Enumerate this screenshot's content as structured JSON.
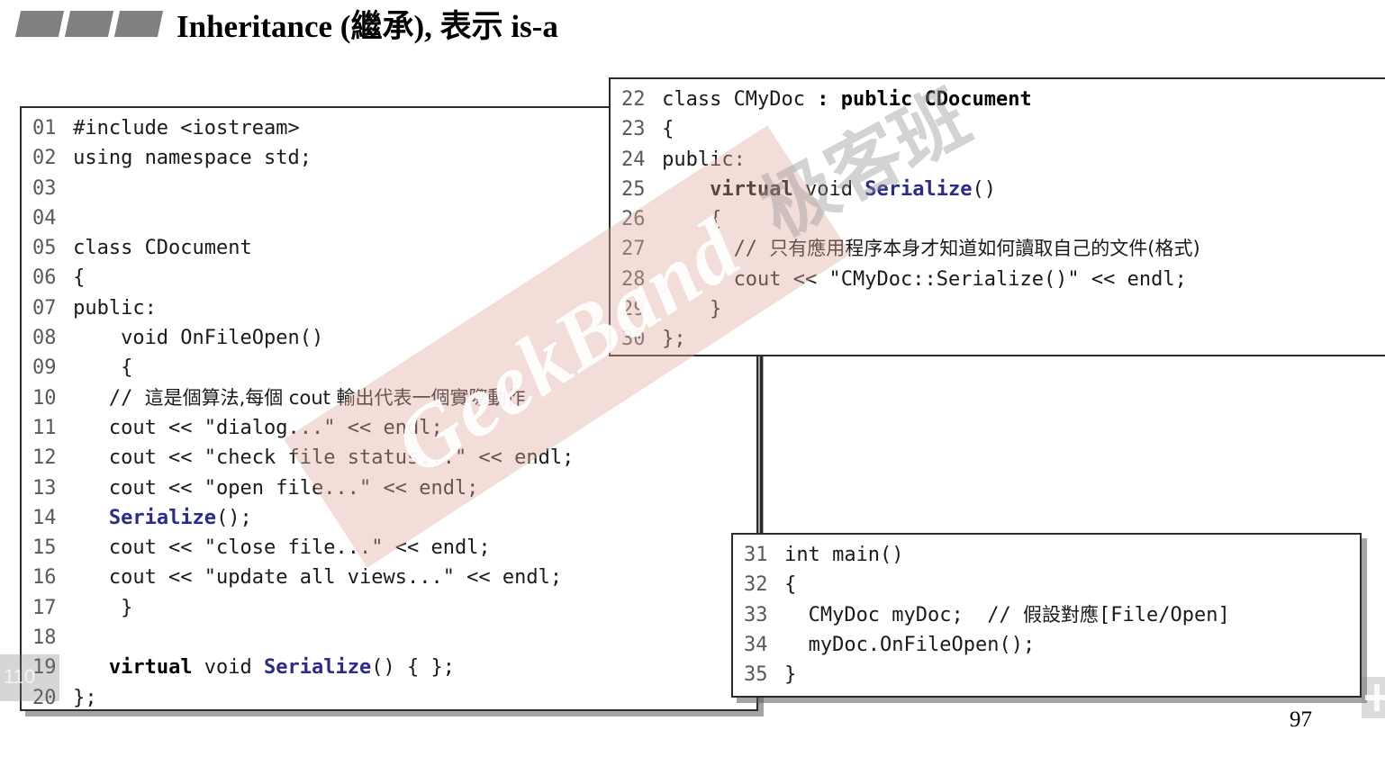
{
  "slide": {
    "title": "Inheritance (繼承), 表示 is-a",
    "page_number": "97",
    "decoration_marks": 3
  },
  "colors": {
    "title_mark": "#808080",
    "keyword_bold": "#000000",
    "function_blue": "#2b2b8c",
    "line_number": "#595959",
    "box_border": "#2b2b2b",
    "watermark_band": "#e2aaa0"
  },
  "watermarks": {
    "brand_latin": "GeekBand",
    "brand_chinese": "极客班"
  },
  "player_overlay": {
    "counter": "110",
    "plus_icon": "plus-icon"
  },
  "code_boxes": [
    {
      "id": "base-class",
      "lines": [
        {
          "n": "01",
          "segments": [
            {
              "t": "#include <iostream>",
              "style": "plain"
            }
          ]
        },
        {
          "n": "02",
          "segments": [
            {
              "t": "using namespace std;",
              "style": "plain"
            }
          ]
        },
        {
          "n": "03",
          "segments": [
            {
              "t": "",
              "style": "plain"
            }
          ]
        },
        {
          "n": "04",
          "segments": [
            {
              "t": "",
              "style": "plain"
            }
          ]
        },
        {
          "n": "05",
          "segments": [
            {
              "t": "class CDocument",
              "style": "plain"
            }
          ]
        },
        {
          "n": "06",
          "segments": [
            {
              "t": "{",
              "style": "plain"
            }
          ]
        },
        {
          "n": "07",
          "segments": [
            {
              "t": "public:",
              "style": "plain"
            }
          ]
        },
        {
          "n": "08",
          "segments": [
            {
              "t": "    void OnFileOpen()",
              "style": "plain"
            }
          ]
        },
        {
          "n": "09",
          "segments": [
            {
              "t": "    {",
              "style": "plain"
            }
          ]
        },
        {
          "n": "10",
          "segments": [
            {
              "t": "   // ",
              "style": "plain"
            },
            {
              "t": "這是個算法,每個 cout 輸出代表一個實際動作",
              "style": "zh"
            }
          ]
        },
        {
          "n": "11",
          "segments": [
            {
              "t": "   cout << \"dialog...\" << endl;",
              "style": "plain"
            }
          ]
        },
        {
          "n": "12",
          "segments": [
            {
              "t": "   cout << \"check file status...\" << endl;",
              "style": "plain"
            }
          ]
        },
        {
          "n": "13",
          "segments": [
            {
              "t": "   cout << \"open file...\" << endl;",
              "style": "plain"
            }
          ]
        },
        {
          "n": "14",
          "segments": [
            {
              "t": "   ",
              "style": "plain"
            },
            {
              "t": "Serialize",
              "style": "fn"
            },
            {
              "t": "();",
              "style": "plain"
            }
          ]
        },
        {
          "n": "15",
          "segments": [
            {
              "t": "   cout << \"close file...\" << endl;",
              "style": "plain"
            }
          ]
        },
        {
          "n": "16",
          "segments": [
            {
              "t": "   cout << \"update all views...\" << endl;",
              "style": "plain"
            }
          ]
        },
        {
          "n": "17",
          "segments": [
            {
              "t": "    }",
              "style": "plain"
            }
          ]
        },
        {
          "n": "18",
          "segments": [
            {
              "t": "",
              "style": "plain"
            }
          ]
        },
        {
          "n": "19",
          "segments": [
            {
              "t": "   ",
              "style": "plain"
            },
            {
              "t": "virtual",
              "style": "kw"
            },
            {
              "t": " void ",
              "style": "plain"
            },
            {
              "t": "Serialize",
              "style": "fn"
            },
            {
              "t": "() { };",
              "style": "plain"
            }
          ]
        },
        {
          "n": "20",
          "segments": [
            {
              "t": "};",
              "style": "plain"
            }
          ]
        }
      ]
    },
    {
      "id": "derived-class",
      "lines": [
        {
          "n": "22",
          "segments": [
            {
              "t": "class CMyDoc ",
              "style": "plain"
            },
            {
              "t": ": public CDocument",
              "style": "kw"
            }
          ]
        },
        {
          "n": "23",
          "segments": [
            {
              "t": "{",
              "style": "plain"
            }
          ]
        },
        {
          "n": "24",
          "segments": [
            {
              "t": "public:",
              "style": "plain"
            }
          ]
        },
        {
          "n": "25",
          "segments": [
            {
              "t": "    ",
              "style": "plain"
            },
            {
              "t": "virtual",
              "style": "kw"
            },
            {
              "t": " void ",
              "style": "plain"
            },
            {
              "t": "Serialize",
              "style": "fn"
            },
            {
              "t": "()",
              "style": "plain"
            }
          ]
        },
        {
          "n": "26",
          "segments": [
            {
              "t": "    {",
              "style": "plain"
            }
          ]
        },
        {
          "n": "27",
          "segments": [
            {
              "t": "      // ",
              "style": "plain"
            },
            {
              "t": "只有應用程序本身才知道如何讀取自己的文件(格式)",
              "style": "zh"
            }
          ]
        },
        {
          "n": "28",
          "segments": [
            {
              "t": "      cout << \"CMyDoc::Serialize()\" << endl;",
              "style": "plain"
            }
          ]
        },
        {
          "n": "29",
          "segments": [
            {
              "t": "    }",
              "style": "plain"
            }
          ]
        },
        {
          "n": "30",
          "segments": [
            {
              "t": "};",
              "style": "plain"
            }
          ]
        }
      ]
    },
    {
      "id": "main-function",
      "lines": [
        {
          "n": "31",
          "segments": [
            {
              "t": "int main()",
              "style": "plain"
            }
          ]
        },
        {
          "n": "32",
          "segments": [
            {
              "t": "{",
              "style": "plain"
            }
          ]
        },
        {
          "n": "33",
          "segments": [
            {
              "t": "  CMyDoc myDoc;  // ",
              "style": "plain"
            },
            {
              "t": "假設對應",
              "style": "zh"
            },
            {
              "t": "[File/Open]",
              "style": "plain"
            }
          ]
        },
        {
          "n": "34",
          "segments": [
            {
              "t": "  myDoc.OnFileOpen();",
              "style": "plain"
            }
          ]
        },
        {
          "n": "35",
          "segments": [
            {
              "t": "}",
              "style": "plain"
            }
          ]
        }
      ]
    }
  ]
}
